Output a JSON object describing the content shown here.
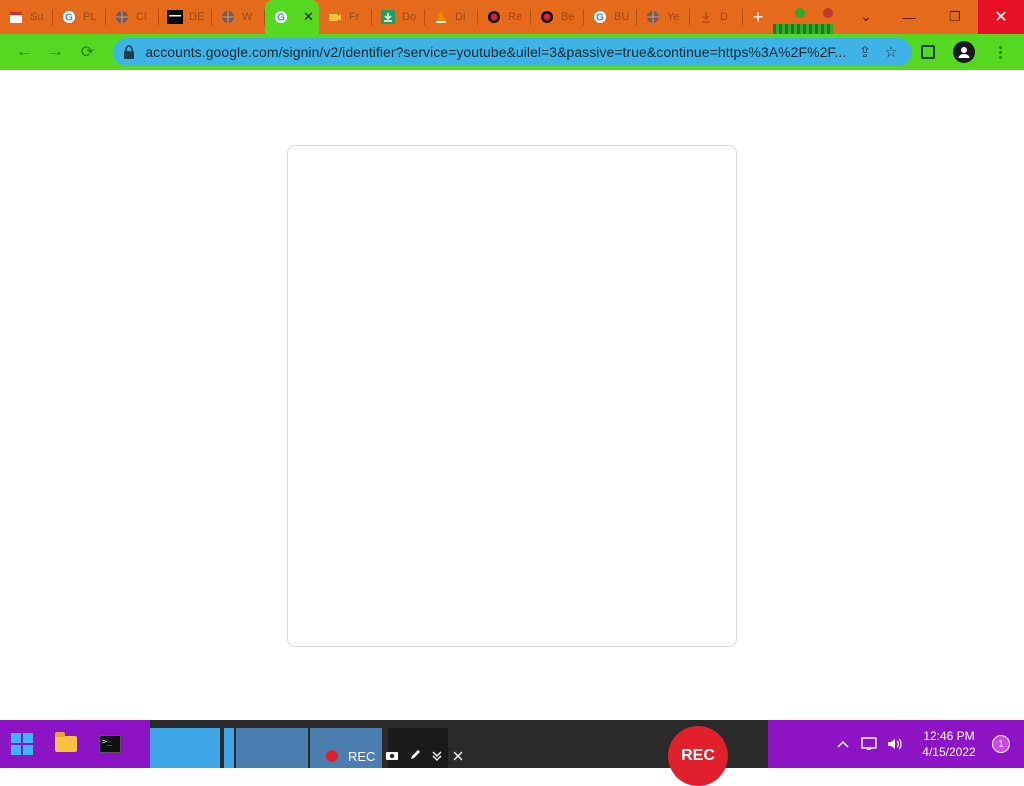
{
  "browser": {
    "tabs": [
      {
        "title": "Su",
        "icon": "calendar-icon",
        "active": false
      },
      {
        "title": "PL",
        "icon": "google-icon",
        "active": false
      },
      {
        "title": "Cl",
        "icon": "globe-icon",
        "active": false
      },
      {
        "title": "DE",
        "icon": "black-site-icon",
        "active": false
      },
      {
        "title": "W",
        "icon": "globe-icon",
        "active": false
      },
      {
        "title": "",
        "icon": "google-icon",
        "active": true,
        "close_label": "✕"
      },
      {
        "title": "Fr",
        "icon": "video-camera-icon",
        "active": false
      },
      {
        "title": "Do",
        "icon": "download-icon",
        "active": false
      },
      {
        "title": "Di",
        "icon": "vlc-icon",
        "active": false
      },
      {
        "title": "Re",
        "icon": "record-icon",
        "active": false
      },
      {
        "title": "Be",
        "icon": "record-icon",
        "active": false
      },
      {
        "title": "BU",
        "icon": "google-icon",
        "active": false
      },
      {
        "title": "Ye",
        "icon": "globe-icon",
        "active": false
      },
      {
        "title": "D",
        "icon": "download-icon",
        "active": false
      }
    ],
    "new_tab_label": "+",
    "window_controls": {
      "dropdown": "⌄",
      "minimize": "—",
      "restore": "❐",
      "close": "✕"
    },
    "toolbar": {
      "back": "←",
      "forward": "→",
      "reload": "⟳",
      "url": "accounts.google.com/signin/v2/identifier?service=youtube&uilel=3&passive=true&continue=https%3A%2F%2F...",
      "share": "⇪",
      "bookmark": "☆"
    }
  },
  "taskbar": {
    "recorder": {
      "rec_label": "REC",
      "big_rec_label": "REC"
    },
    "clock": {
      "time": "12:46 PM",
      "date": "4/15/2022"
    },
    "notification_count": "1"
  },
  "colors": {
    "tabstrip": "#e56a1c",
    "toolbar": "#55d820",
    "omnibox": "#3fb3e5",
    "taskbar": "#8d14c4",
    "close_button": "#e81123",
    "rec": "#e0202a"
  }
}
